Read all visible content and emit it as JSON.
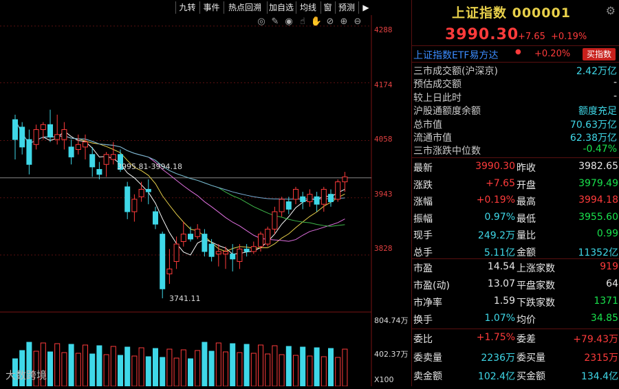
{
  "toolbar": {
    "buttons": [
      "九转",
      "事件",
      "热点回溯",
      "加自选",
      "均线",
      "窗",
      "预测"
    ],
    "icons": [
      "target-icon",
      "brush-icon",
      "eye-icon",
      "pointer-icon",
      "hand-icon",
      "hide-icon",
      "zoom-in-icon",
      "zoom-out-icon"
    ]
  },
  "chart_data": {
    "type": "candlestick",
    "yaxis_ticks": [
      "4288",
      "4174",
      "4058",
      "3943",
      "3828"
    ],
    "ylim": [
      3730,
      4310
    ],
    "annotations": {
      "high_label": "3995.81-3994.18",
      "low_label": "3741.11"
    },
    "volume_ticks": [
      "804.74万",
      "402.37万",
      "X100"
    ],
    "candles": [
      {
        "o": 4060,
        "c": 4100,
        "h": 4110,
        "l": 4020,
        "up": false
      },
      {
        "o": 4085,
        "c": 4045,
        "h": 4095,
        "l": 4030,
        "up": false
      },
      {
        "o": 4060,
        "c": 4010,
        "h": 4080,
        "l": 3990,
        "up": false
      },
      {
        "o": 4050,
        "c": 4080,
        "h": 4090,
        "l": 4040,
        "up": true
      },
      {
        "o": 4080,
        "c": 4090,
        "h": 4095,
        "l": 4060,
        "up": true
      },
      {
        "o": 4090,
        "c": 4065,
        "h": 4120,
        "l": 4055,
        "up": false
      },
      {
        "o": 4060,
        "c": 4070,
        "h": 4110,
        "l": 4050,
        "up": true
      },
      {
        "o": 4060,
        "c": 4080,
        "h": 4095,
        "l": 4040,
        "up": true
      },
      {
        "o": 4045,
        "c": 4025,
        "h": 4060,
        "l": 4010,
        "up": false
      },
      {
        "o": 4040,
        "c": 4050,
        "h": 4070,
        "l": 4030,
        "up": true
      },
      {
        "o": 4045,
        "c": 4055,
        "h": 4070,
        "l": 4020,
        "up": true
      },
      {
        "o": 4030,
        "c": 4005,
        "h": 4045,
        "l": 3985,
        "up": false
      },
      {
        "o": 4000,
        "c": 3990,
        "h": 4015,
        "l": 3980,
        "up": false
      },
      {
        "o": 4010,
        "c": 4030,
        "h": 4035,
        "l": 3985,
        "up": true
      },
      {
        "o": 4020,
        "c": 4030,
        "h": 4055,
        "l": 4010,
        "up": true
      },
      {
        "o": 4030,
        "c": 4000,
        "h": 4040,
        "l": 3995,
        "up": false
      },
      {
        "o": 3965,
        "c": 3915,
        "h": 3975,
        "l": 3900,
        "up": false
      },
      {
        "o": 3915,
        "c": 3940,
        "h": 3950,
        "l": 3895,
        "up": true
      },
      {
        "o": 3945,
        "c": 3960,
        "h": 3975,
        "l": 3935,
        "up": true
      },
      {
        "o": 3960,
        "c": 3955,
        "h": 3980,
        "l": 3930,
        "up": false
      },
      {
        "o": 3915,
        "c": 3890,
        "h": 3925,
        "l": 3880,
        "up": false
      },
      {
        "o": 3870,
        "c": 3760,
        "h": 3875,
        "l": 3741,
        "up": false
      },
      {
        "o": 3790,
        "c": 3800,
        "h": 3840,
        "l": 3770,
        "up": true
      },
      {
        "o": 3815,
        "c": 3850,
        "h": 3865,
        "l": 3800,
        "up": true
      },
      {
        "o": 3855,
        "c": 3870,
        "h": 3895,
        "l": 3845,
        "up": true
      },
      {
        "o": 3870,
        "c": 3860,
        "h": 3885,
        "l": 3855,
        "up": false
      },
      {
        "o": 3865,
        "c": 3880,
        "h": 3890,
        "l": 3860,
        "up": true
      },
      {
        "o": 3870,
        "c": 3835,
        "h": 3880,
        "l": 3825,
        "up": false
      },
      {
        "o": 3850,
        "c": 3825,
        "h": 3860,
        "l": 3815,
        "up": false
      },
      {
        "o": 3830,
        "c": 3835,
        "h": 3850,
        "l": 3805,
        "up": true
      },
      {
        "o": 3830,
        "c": 3835,
        "h": 3845,
        "l": 3800,
        "up": true
      },
      {
        "o": 3830,
        "c": 3820,
        "h": 3850,
        "l": 3795,
        "up": false
      },
      {
        "o": 3815,
        "c": 3840,
        "h": 3850,
        "l": 3800,
        "up": true
      },
      {
        "o": 3835,
        "c": 3840,
        "h": 3850,
        "l": 3825,
        "up": false
      },
      {
        "o": 3835,
        "c": 3845,
        "h": 3855,
        "l": 3830,
        "up": true
      },
      {
        "o": 3845,
        "c": 3870,
        "h": 3875,
        "l": 3835,
        "up": true
      },
      {
        "o": 3850,
        "c": 3880,
        "h": 3885,
        "l": 3845,
        "up": true
      },
      {
        "o": 3880,
        "c": 3915,
        "h": 3925,
        "l": 3870,
        "up": true
      },
      {
        "o": 3915,
        "c": 3940,
        "h": 3945,
        "l": 3905,
        "up": true
      },
      {
        "o": 3935,
        "c": 3920,
        "h": 3945,
        "l": 3910,
        "up": false
      },
      {
        "o": 3940,
        "c": 3960,
        "h": 3965,
        "l": 3930,
        "up": true
      },
      {
        "o": 3945,
        "c": 3935,
        "h": 3955,
        "l": 3920,
        "up": false
      },
      {
        "o": 3935,
        "c": 3950,
        "h": 3960,
        "l": 3925,
        "up": true
      },
      {
        "o": 3945,
        "c": 3930,
        "h": 3955,
        "l": 3915,
        "up": false
      },
      {
        "o": 3930,
        "c": 3960,
        "h": 3965,
        "l": 3915,
        "up": true
      },
      {
        "o": 3935,
        "c": 3950,
        "h": 3960,
        "l": 3925,
        "up": false
      },
      {
        "o": 3940,
        "c": 3975,
        "h": 3980,
        "l": 3935,
        "up": true
      },
      {
        "o": 3975,
        "c": 3985,
        "h": 3995,
        "l": 3955,
        "up": true
      }
    ]
  },
  "panel": {
    "title": "上证指数 000001",
    "price": "3990.30",
    "change": "+7.65",
    "change_pct": "+0.19%",
    "etf_name": "上证指数ETF易方达",
    "etf_pct": "+0.20%",
    "buy_label": "买指数",
    "info": [
      {
        "k": "三市成交额(沪深京)",
        "v": "2.42万亿",
        "c": "cyan"
      },
      {
        "k": "预估成交额",
        "v": "-",
        "c": "white"
      },
      {
        "k": "较上日此时",
        "v": "-",
        "c": "white"
      },
      {
        "k": "沪股通额度余额",
        "v": "额度充足",
        "c": "cyan"
      },
      {
        "k": "总市值",
        "v": "70.63万亿",
        "c": "cyan"
      },
      {
        "k": "流通市值",
        "v": "62.38万亿",
        "c": "cyan"
      },
      {
        "k": "三市涨跌中位数",
        "v": "-0.47%",
        "c": "green"
      }
    ],
    "quotes": [
      {
        "k1": "最新",
        "v1": "3990.30",
        "c1": "red",
        "k2": "昨收",
        "v2": "3982.65",
        "c2": "white"
      },
      {
        "k1": "涨跌",
        "v1": "+7.65",
        "c1": "red",
        "k2": "开盘",
        "v2": "3979.49",
        "c2": "green"
      },
      {
        "k1": "涨幅",
        "v1": "+0.19%",
        "c1": "red",
        "k2": "最高",
        "v2": "3994.18",
        "c2": "red"
      },
      {
        "k1": "振幅",
        "v1": "0.97%",
        "c1": "cyan",
        "k2": "最低",
        "v2": "3955.60",
        "c2": "green"
      },
      {
        "k1": "现手",
        "v1": "249.2万",
        "c1": "cyan",
        "k2": "量比",
        "v2": "0.99",
        "c2": "green"
      },
      {
        "k1": "总手",
        "v1": "5.11亿",
        "c1": "cyan",
        "k2": "金额",
        "v2": "11352亿",
        "c2": "cyan"
      }
    ],
    "stats": [
      {
        "k1": "市盈",
        "v1": "14.54",
        "c1": "white",
        "k2": "上涨家数",
        "v2": "919",
        "c2": "red"
      },
      {
        "k1": "市盈(动)",
        "v1": "13.07",
        "c1": "white",
        "k2": "平盘家数",
        "v2": "64",
        "c2": "white"
      },
      {
        "k1": "市净率",
        "v1": "1.59",
        "c1": "white",
        "k2": "下跌家数",
        "v2": "1371",
        "c2": "green"
      },
      {
        "k1": "换手",
        "v1": "1.07%",
        "c1": "cyan",
        "k2": "均价",
        "v2": "34.85",
        "c2": "green"
      }
    ],
    "orders": [
      {
        "k1": "委比",
        "v1": "+1.75%",
        "c1": "red",
        "k2": "委差",
        "v2": "+79.43万",
        "c2": "red"
      },
      {
        "k1": "委卖量",
        "v1": "2236万",
        "c1": "cyan",
        "k2": "委买量",
        "v2": "2315万",
        "c2": "red"
      },
      {
        "k1": "卖金额",
        "v1": "102.4亿",
        "c1": "cyan",
        "k2": "买金额",
        "v2": "134.4亿",
        "c2": "cyan"
      }
    ]
  },
  "watermark": "大数跨境"
}
